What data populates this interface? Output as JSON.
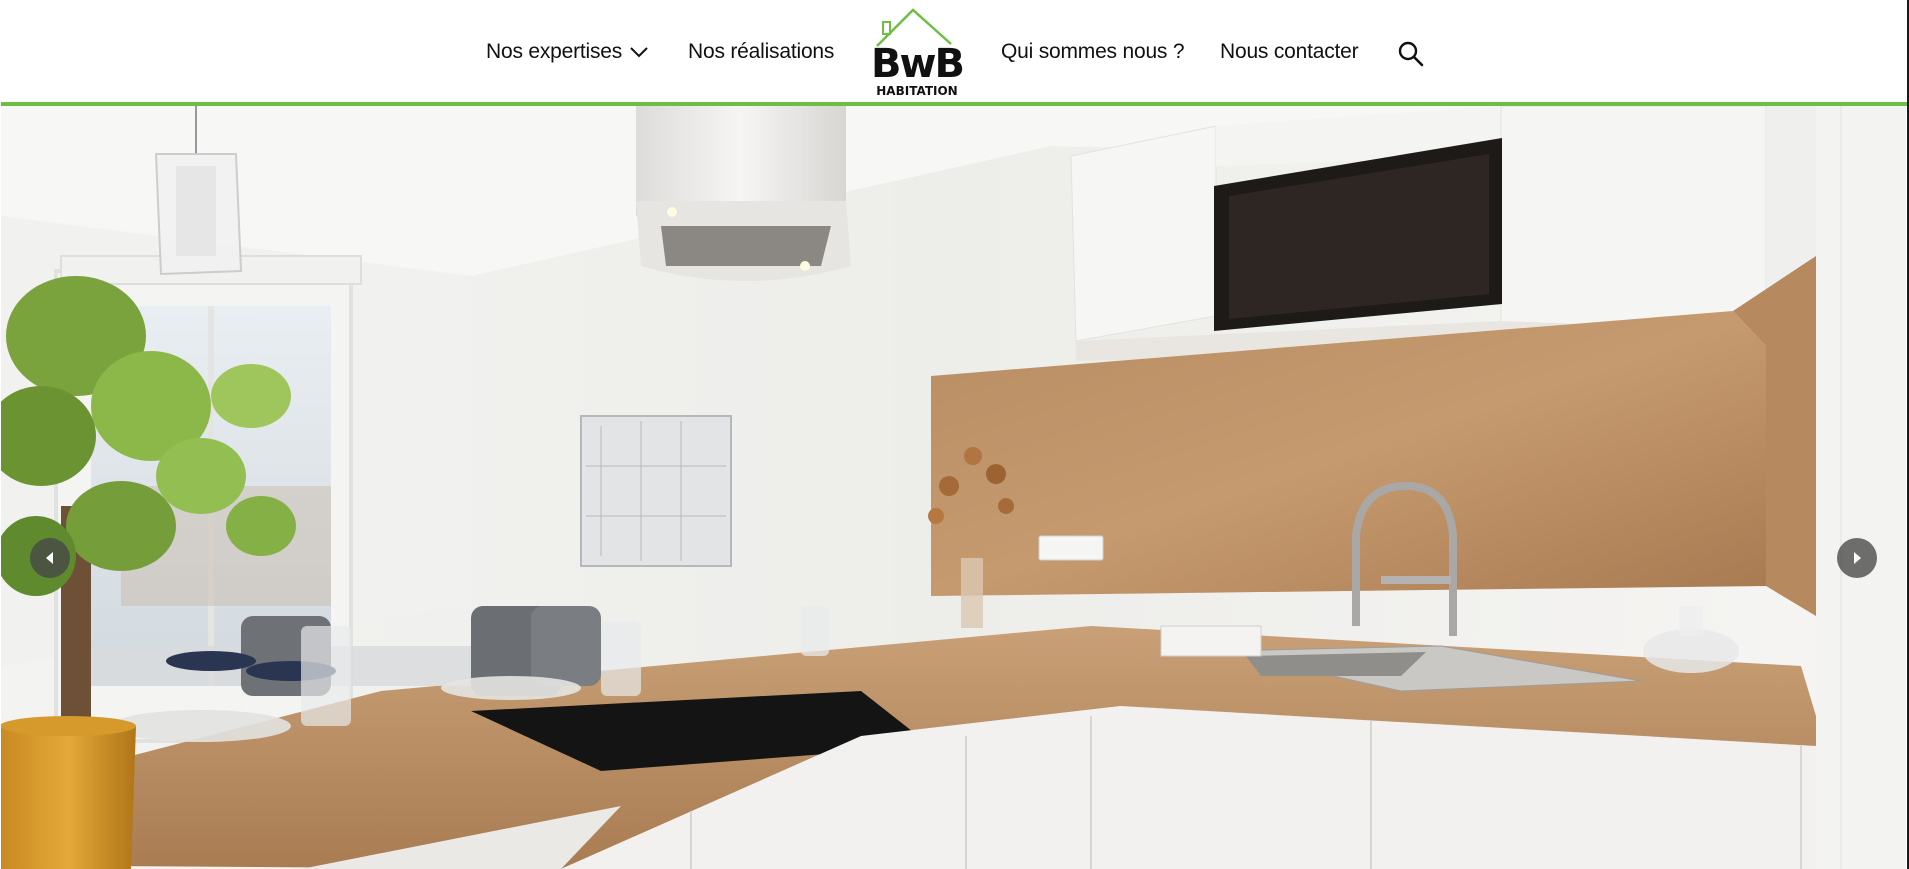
{
  "nav": {
    "expertises_label": "Nos expertises",
    "realisations_label": "Nos réalisations",
    "qui_label": "Qui sommes nous ?",
    "contact_label": "Nous contacter",
    "search_icon": "search-icon",
    "dropdown_icon": "chevron-down-icon"
  },
  "logo": {
    "main": "BwB",
    "sub": "HABITATION"
  },
  "hero": {
    "slideshow_prev_icon": "chevron-left-icon",
    "slideshow_next_icon": "chevron-right-icon"
  },
  "colors": {
    "accent_green": "#6fbe44",
    "text": "#111111",
    "arrow_bg": "#464646"
  }
}
